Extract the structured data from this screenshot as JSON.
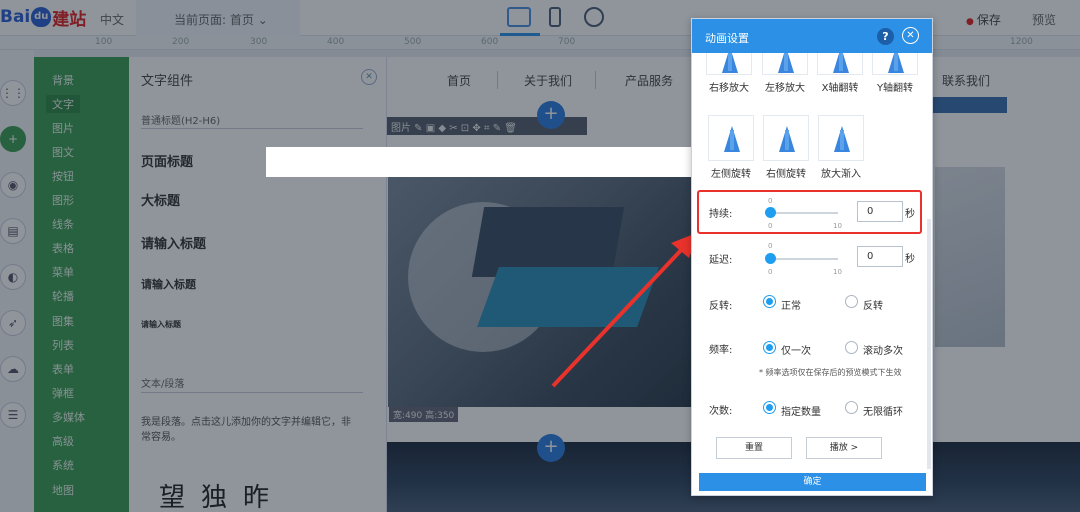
{
  "topbar": {
    "logo_left": "Bai",
    "logo_mid": "du",
    "logo_right": "建站",
    "lang": "中文",
    "current_page": "当前页面: 首页",
    "save": "保存",
    "preview": "预览"
  },
  "ruler": [
    "100",
    "200",
    "300",
    "400",
    "500",
    "600",
    "700",
    "1200"
  ],
  "component_nav": [
    "背景",
    "文字",
    "图片",
    "图文",
    "按钮",
    "图形",
    "线条",
    "表格",
    "菜单",
    "轮播",
    "图集",
    "列表",
    "表单",
    "弹框",
    "多媒体",
    "高级",
    "系统",
    "地图"
  ],
  "text_panel": {
    "title": "文字组件",
    "subtitle_h": "普通标题(H2-H6)",
    "page_title": "页面标题",
    "big_title": "大标题",
    "input_title_1": "请输入标题",
    "input_title_2": "请输入标题",
    "input_title_3": "请输入标题",
    "paragraph_label": "文本/段落",
    "paragraph_text": "我是段落。点击这儿添加你的文字并编辑它，非常容易。",
    "calligraphy": "望独昨"
  },
  "canvas": {
    "nav": [
      "首页",
      "关于我们",
      "产品服务",
      "联系我们"
    ],
    "img_tool_label": "图片",
    "size_label": "宽:490 高:350"
  },
  "dialog": {
    "title": "动画设置",
    "help": "?",
    "animations_top": [
      "右移放大",
      "左移放大",
      "X轴翻转",
      "Y轴翻转"
    ],
    "animations_mid": [
      "左侧旋转",
      "右侧旋转",
      "放大渐入"
    ],
    "duration": {
      "label": "持续:",
      "min": "0",
      "max": "10",
      "top_tick": "0",
      "value": "0",
      "unit": "秒"
    },
    "delay": {
      "label": "延迟:",
      "min": "0",
      "max": "10",
      "top_tick": "0",
      "value": "0",
      "unit": "秒"
    },
    "reverse": {
      "label": "反转:",
      "options": [
        "正常",
        "反转"
      ],
      "selected": "正常"
    },
    "frequency": {
      "label": "频率:",
      "options": [
        "仅一次",
        "滚动多次"
      ],
      "selected": "仅一次"
    },
    "frequency_note": "* 频率选项仅在保存后的预览模式下生效",
    "count": {
      "label": "次数:",
      "options": [
        "指定数量",
        "无限循环"
      ],
      "selected": "指定数量"
    },
    "reset_button": "重置",
    "play_button": "播放 >",
    "ok_button": "确定"
  },
  "colors": {
    "accent": "#2b90e6",
    "highlight": "#e8322b",
    "nav_green": "#3b9e50"
  }
}
